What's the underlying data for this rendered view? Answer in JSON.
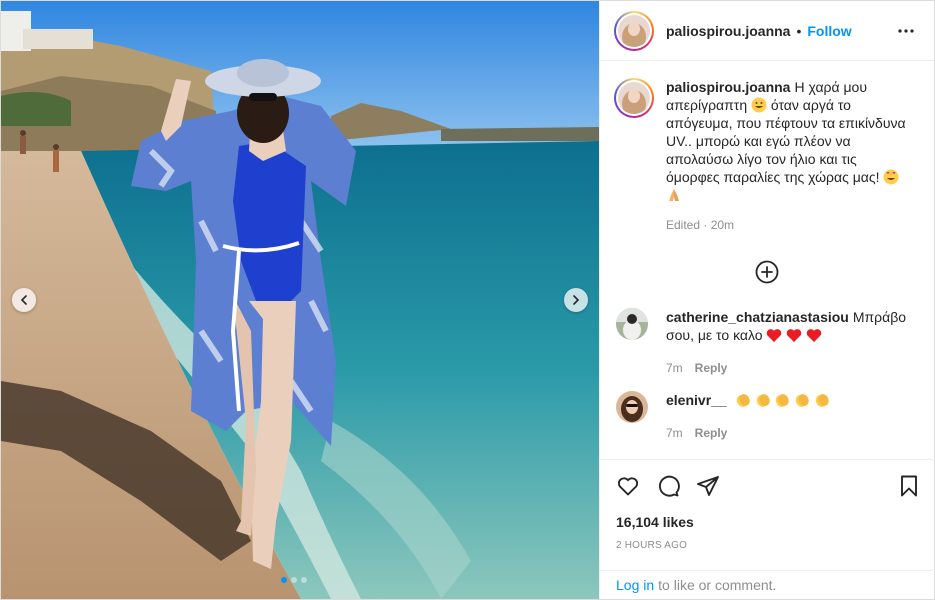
{
  "post": {
    "author": "paliospirou.joanna",
    "bullet": "•",
    "follow_label": "Follow",
    "more_icon": "more-options-icon",
    "carousel": {
      "total_slides": 3,
      "active_slide": 1
    }
  },
  "caption": {
    "username": "paliospirou.joanna",
    "text_part1": "Η χαρά μου απερίγραπτη",
    "text_part2": "όταν αργά το απόγευμα, που πέφτουν τα επικίνδυνα UV.. μπορώ και εγώ πλέον να απολαύσω λίγο τον ήλιο και τις όμορφες παραλίες της χώρας μας!",
    "edited": "Edited",
    "time": "20m"
  },
  "comments": [
    {
      "username": "catherine_chatzianastasiou",
      "text": "Μπράβο σου, με το καλο",
      "time": "7m",
      "reply_label": "Reply",
      "emojis": [
        "red-heart",
        "red-heart",
        "red-heart"
      ]
    },
    {
      "username": "elenivr__",
      "text": "",
      "time": "7m",
      "reply_label": "Reply",
      "emojis": [
        "clapping-hands",
        "clapping-hands",
        "clapping-hands",
        "clapping-hands",
        "clapping-hands"
      ]
    }
  ],
  "actions": {
    "likes": "16,104 likes",
    "posted": "2 HOURS AGO",
    "login_label": "Log in",
    "login_suffix": "to like or comment."
  },
  "colors": {
    "accent": "#0095f6",
    "muted": "#8e8e8e",
    "text": "#262626",
    "heart": "#ed1c24"
  }
}
